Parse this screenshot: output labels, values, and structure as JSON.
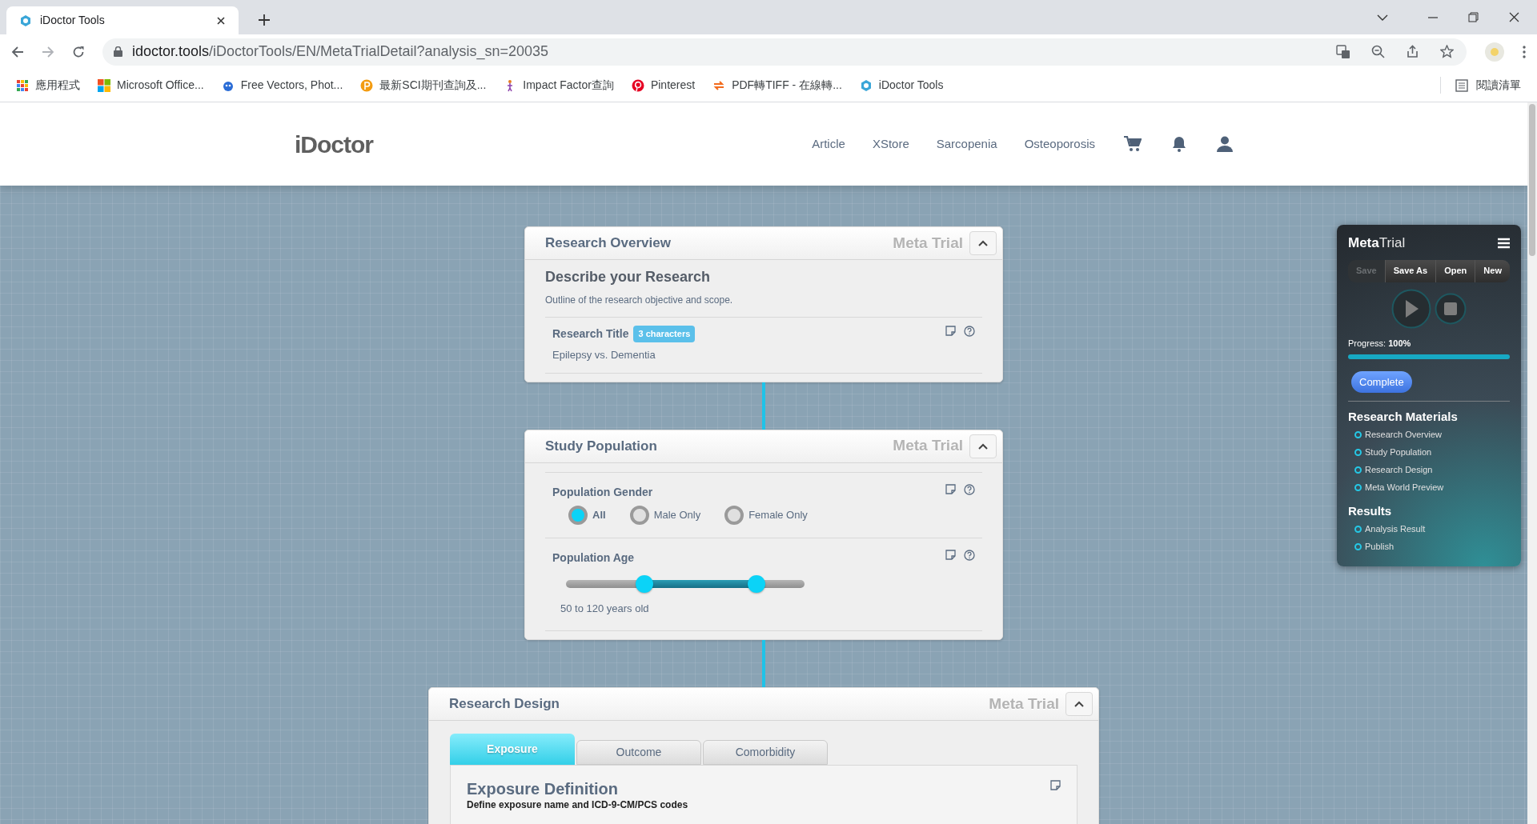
{
  "browser": {
    "tabs": [
      {
        "title": "iDoctor Tools",
        "selected": true
      }
    ],
    "url_host": "idoctor.tools",
    "url_path": "/iDoctorTools/EN/MetaTrialDetail?analysis_sn=20035",
    "bookmarks": [
      "應用程式",
      "Microsoft Office...",
      "Free Vectors, Phot...",
      "最新SCI期刊查詢及...",
      "Impact Factor查詢",
      "Pinterest",
      "PDF轉TIFF - 在線轉...",
      "iDoctor Tools"
    ],
    "reading_list": "閱讀清單"
  },
  "site_header": {
    "logo": "iDoctor",
    "nav": [
      "Article",
      "XStore",
      "Sarcopenia",
      "Osteoporosis"
    ]
  },
  "cards": [
    {
      "kind": "overview",
      "title": "Research Overview",
      "watermark": "Meta Trial",
      "expanded": true,
      "heading": "Describe your Research",
      "description": "Outline of the research objective and scope.",
      "field": {
        "label": "Research Title",
        "badge": "3 characters",
        "value": "Epilepsy vs. Dementia"
      }
    },
    {
      "kind": "population",
      "title": "Study Population",
      "watermark": "Meta Trial",
      "expanded": true,
      "gender": {
        "label": "Population Gender",
        "options": [
          {
            "label": "All",
            "selected": true
          },
          {
            "label": "Male Only",
            "selected": false
          },
          {
            "label": "Female Only",
            "selected": false
          }
        ]
      },
      "age": {
        "label": "Population Age",
        "thumbs": [
          {
            "level": 0.33
          },
          {
            "level": 0.8
          }
        ],
        "reading": "50 to 120 years old"
      }
    },
    {
      "kind": "design",
      "title": "Research Design",
      "watermark": "Meta Trial",
      "expanded": true,
      "tabs": [
        {
          "label": "Exposure",
          "selected": true
        },
        {
          "label": "Outcome",
          "selected": false
        },
        {
          "label": "Comorbidity",
          "selected": false
        }
      ],
      "heading": "Exposure Definition",
      "description": "Define exposure name and ICD-9-CM/PCS codes"
    }
  ],
  "meta_panel": {
    "title_bold": "Meta",
    "title_light": "Trial",
    "buttons": [
      {
        "label": "Save",
        "disabled": true
      },
      {
        "label": "Save As",
        "disabled": false
      },
      {
        "label": "Open",
        "disabled": false
      },
      {
        "label": "New",
        "disabled": false
      }
    ],
    "progress": "Progress: **100%**",
    "level": 1,
    "status_button": "Complete",
    "sections": [
      {
        "title": "Research Materials",
        "items": [
          "Research Overview",
          "Study Population",
          "Research Design",
          "Meta World Preview"
        ]
      },
      {
        "title": "Results",
        "items": [
          "Analysis Result",
          "Publish"
        ]
      }
    ]
  }
}
